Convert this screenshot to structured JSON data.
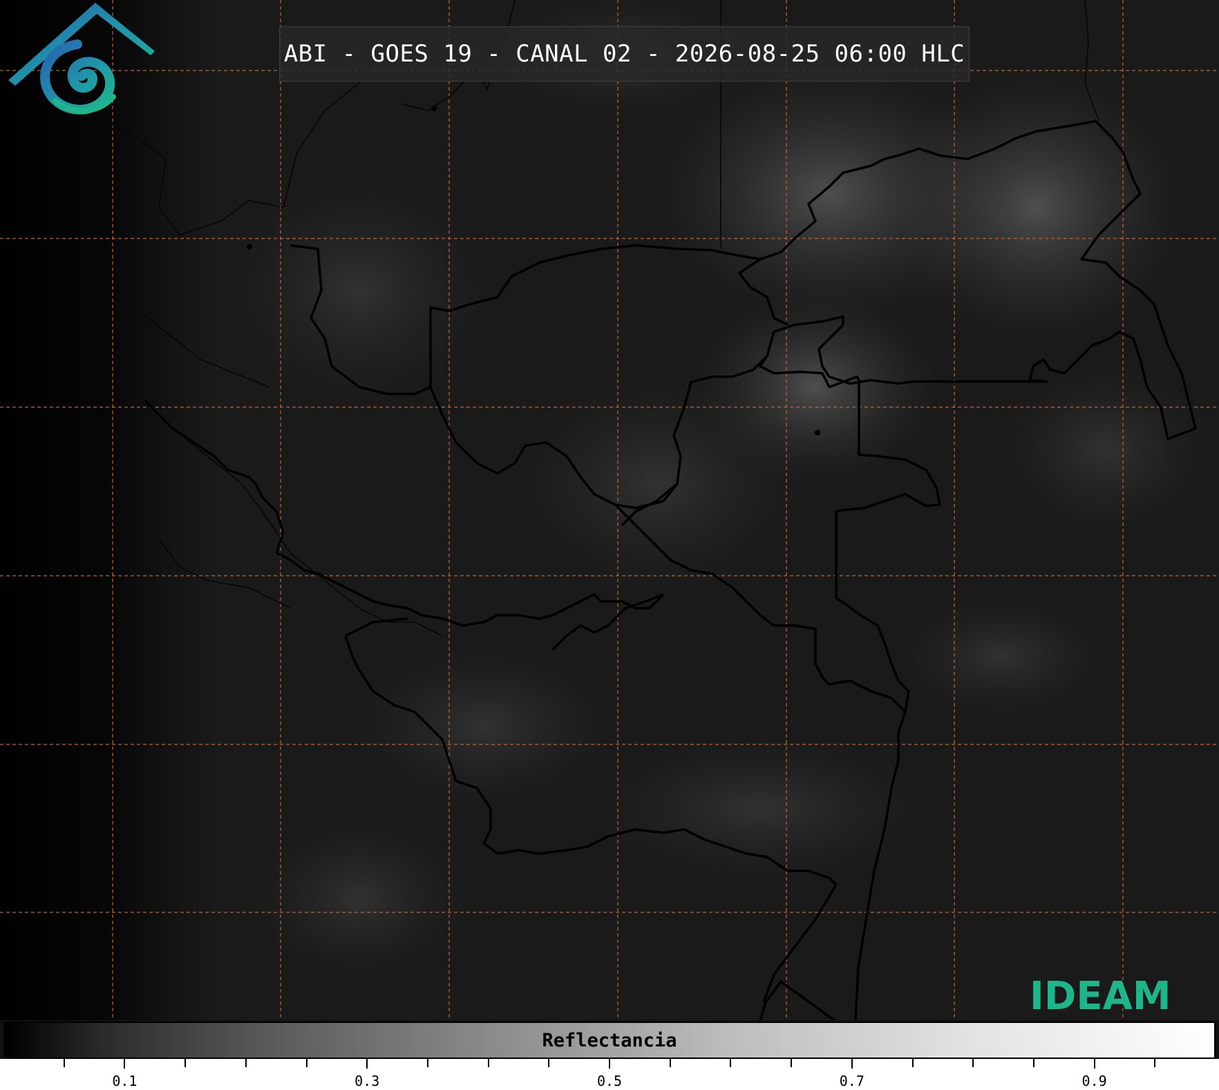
{
  "title": "ABI - GOES 19 - CANAL 02 - 2026-08-25 06:00 HLC",
  "logo": {
    "text": "IDEAM",
    "color": "#1fb58a"
  },
  "colorbar": {
    "label": "Reflectancia",
    "range": [
      0.0,
      1.0
    ],
    "ticks": [
      0.1,
      0.3,
      0.5,
      0.7,
      0.9
    ],
    "tick_labels": [
      "0.1",
      "0.3",
      "0.5",
      "0.7",
      "0.9"
    ],
    "minor_tick_step": 0.05,
    "colormap": "grayscale"
  },
  "gridlines": {
    "color": "#c0672e",
    "style": "dashed"
  },
  "borders": {
    "color": "#000000"
  }
}
